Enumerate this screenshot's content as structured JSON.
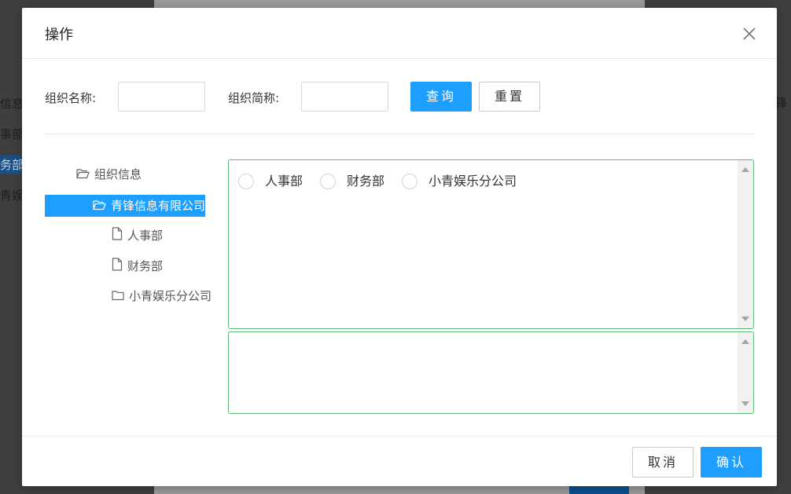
{
  "background": {
    "left_items": [
      "信息",
      "事部",
      "务部",
      "青娱"
    ],
    "right_item": "锋"
  },
  "dialog": {
    "title": "操作",
    "close_icon": "close-icon"
  },
  "search": {
    "org_name_label": "组织名称:",
    "org_name_value": "",
    "org_short_label": "组织简称:",
    "org_short_value": "",
    "query_button": "查询",
    "reset_button": "重置"
  },
  "tree": {
    "root": {
      "label": "组织信息",
      "icon": "folder-open-icon"
    },
    "company": {
      "label": "青锋信息有限公司",
      "icon": "folder-open-icon",
      "selected": true
    },
    "children": [
      {
        "label": "人事部",
        "icon": "file-icon"
      },
      {
        "label": "财务部",
        "icon": "file-icon"
      },
      {
        "label": "小青娱乐分公司",
        "icon": "folder-icon"
      }
    ]
  },
  "options": [
    {
      "label": "人事部",
      "checked": false
    },
    {
      "label": "财务部",
      "checked": false
    },
    {
      "label": "小青娱乐分公司",
      "checked": false
    }
  ],
  "footer": {
    "cancel_button": "取消",
    "confirm_button": "确认"
  },
  "colors": {
    "primary": "#1e9fff",
    "box_border": "#5fb878",
    "overlay": "#4a4a4a"
  }
}
